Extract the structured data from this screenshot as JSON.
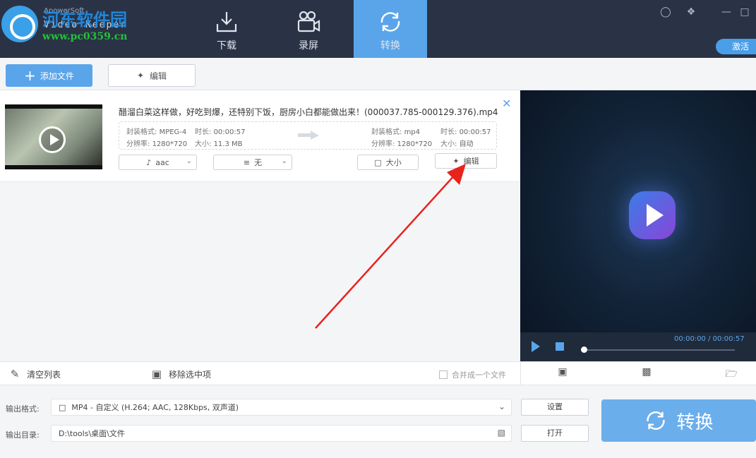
{
  "app": {
    "title_small": "ApowerSoft",
    "app_name": "Video Keeper",
    "watermark": "河东软件园",
    "watermark_url": "www.pc0359.cn",
    "activate_label": "激活"
  },
  "nav": {
    "tabs": [
      {
        "label": "下载",
        "icon": "download-icon"
      },
      {
        "label": "录屏",
        "icon": "video-camera-icon"
      },
      {
        "label": "转换",
        "icon": "convert-icon",
        "active": true
      }
    ]
  },
  "window_controls": [
    "user-icon",
    "skin-icon",
    "minimize-icon",
    "maximize-icon"
  ],
  "toolbar": {
    "add_file_label": "添加文件",
    "edit_label": "编辑"
  },
  "file": {
    "title": "醋溜白菜这样做，好吃到爆，还特别下饭，厨房小白都能做出来！(000037.785-000129.376).mp4",
    "source": {
      "format_label": "封装格式:",
      "format": "MPEG-4",
      "duration_label": "时长:",
      "duration": "00:00:57",
      "resolution_label": "分辨率:",
      "resolution": "1280*720",
      "size_label": "大小:",
      "size": "11.3 MB"
    },
    "target": {
      "format_label": "封装格式:",
      "format": "mp4",
      "duration_label": "时长:",
      "duration": "00:00:57",
      "resolution_label": "分辨率:",
      "resolution": "1280*720",
      "size_label": "大小:",
      "size": "自动"
    },
    "audio_select": "aac",
    "subtitle_select": "无",
    "size_button": "大小",
    "edit_button": "编辑"
  },
  "preview": {
    "time": "00:00:00 / 00:00:57",
    "progress": 0.0
  },
  "listbar": {
    "clear_label": "清空列表",
    "remove_label": "移除选中项",
    "merge_label": "合并成一个文件"
  },
  "output": {
    "format_label": "输出格式:",
    "format_value": "MP4 - 自定义 (H.264; AAC, 128Kbps, 双声道)",
    "dir_label": "输出目录:",
    "dir_value": "D:\\tools\\桌面\\文件",
    "settings_button": "设置",
    "open_button": "打开",
    "convert_button": "转换"
  },
  "colors": {
    "accent": "#5aa5ea",
    "topbar": "#2a3345",
    "annotation": "#e8231c"
  }
}
